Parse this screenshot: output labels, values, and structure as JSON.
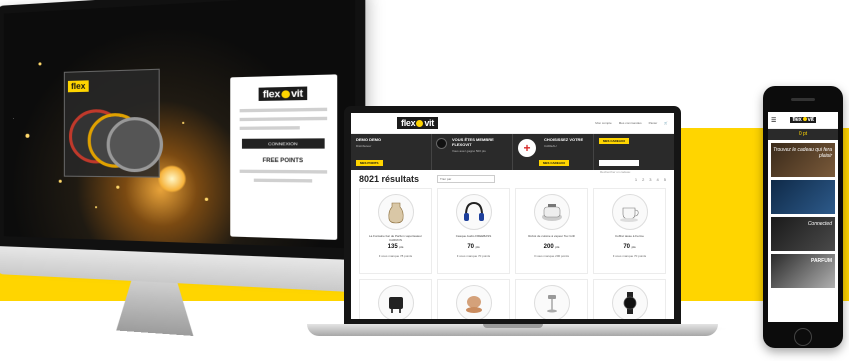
{
  "site": {
    "brand": {
      "left": "flex",
      "right": "vit"
    },
    "header_links": [
      "Mon compte",
      "Mes commandes",
      "Panier"
    ]
  },
  "banner": {
    "cell1_title": "DEMO DEMO",
    "cell1_sub": "Distributeur",
    "cell1_btn": "MES POINTS",
    "cell2_title": "VOUS ÊTES MEMBRE FLEXOVIT",
    "cell2_sub": "Vous avez gagné 500 pts",
    "cell3_title": "CHOISISSEZ VOTRE",
    "cell3_sub": "CADEAU",
    "cell3_btn": "MES CADEAUX",
    "cell4_btn": "MES CADEAUX",
    "cell4_search": "Rechercher un cadeau"
  },
  "results": {
    "count_label": "8021 résultats",
    "sort_placeholder": "Trier par",
    "pager": [
      "1",
      "2",
      "3",
      "4",
      "5"
    ]
  },
  "products": [
    {
      "name": "La Fontaine bar de Parfum vaporisateur CARRON",
      "price": "135",
      "unit": "pts",
      "missing": "Il vous manque 78 points",
      "icon": "vase-icon"
    },
    {
      "name": "Casque Audio FREEBASS",
      "price": "70",
      "unit": "pts",
      "missing": "Il vous manque 70 points",
      "icon": "headphones-icon"
    },
    {
      "name": "Robot de cuisine à vapeur Tex Grill",
      "price": "200",
      "unit": "pts",
      "missing": "Il vous manque 200 points",
      "icon": "steam-cooker-icon"
    },
    {
      "name": "Coffret tasse à Ferme",
      "price": "70",
      "unit": "pts",
      "missing": "Il vous manque 70 points",
      "icon": "cup-icon"
    },
    {
      "name": "",
      "price": "",
      "unit": "",
      "missing": "",
      "icon": "waffle-maker-icon"
    },
    {
      "name": "",
      "price": "",
      "unit": "",
      "missing": "",
      "icon": "cookware-icon"
    },
    {
      "name": "",
      "price": "",
      "unit": "",
      "missing": "",
      "icon": "lamp-icon"
    },
    {
      "name": "",
      "price": "",
      "unit": "",
      "missing": "",
      "icon": "watch-icon"
    }
  ],
  "imac": {
    "panel_button": "CONNEXION",
    "panel_sub": "FREE POINTS",
    "card_brand": "flex"
  },
  "phone": {
    "points": "0 pt",
    "tiles": [
      {
        "title": "Trouvez le cadeau qui fera plaisir",
        "caption": ""
      },
      {
        "title": "",
        "caption": ""
      },
      {
        "title": "Connected",
        "caption": ""
      },
      {
        "title": "PARFUM",
        "caption": ""
      }
    ]
  },
  "colors": {
    "accent": "#ffd500",
    "dark": "#1b1b1b",
    "cross": "#d62828"
  }
}
